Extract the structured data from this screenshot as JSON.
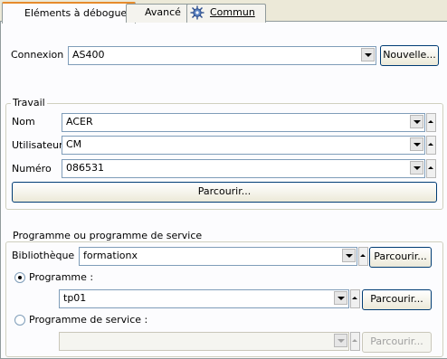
{
  "tabs": [
    {
      "label": "Eléments à déboguer"
    },
    {
      "label": "Avancé"
    },
    {
      "label": "Commun"
    }
  ],
  "connexion": {
    "label": "Connexion :",
    "value": "AS400",
    "button": "Nouvelle..."
  },
  "travail": {
    "title": "Travail",
    "nom": {
      "label": "Nom",
      "value": "ACER"
    },
    "utilisateur": {
      "label": "Utilisateur",
      "value": "CM"
    },
    "numero": {
      "label": "Numéro",
      "value": "086531"
    },
    "browse": "Parcourir..."
  },
  "programme_group": {
    "title": "Programme ou programme de service",
    "bibliotheque": {
      "label": "Bibliothèque :",
      "value": "formationx",
      "browse": "Parcourir..."
    },
    "programme": {
      "label": "Programme :",
      "value": "tp01",
      "browse": "Parcourir...",
      "selected": true
    },
    "service": {
      "label": "Programme de service :",
      "value": "",
      "browse": "Parcourir...",
      "selected": false
    }
  }
}
